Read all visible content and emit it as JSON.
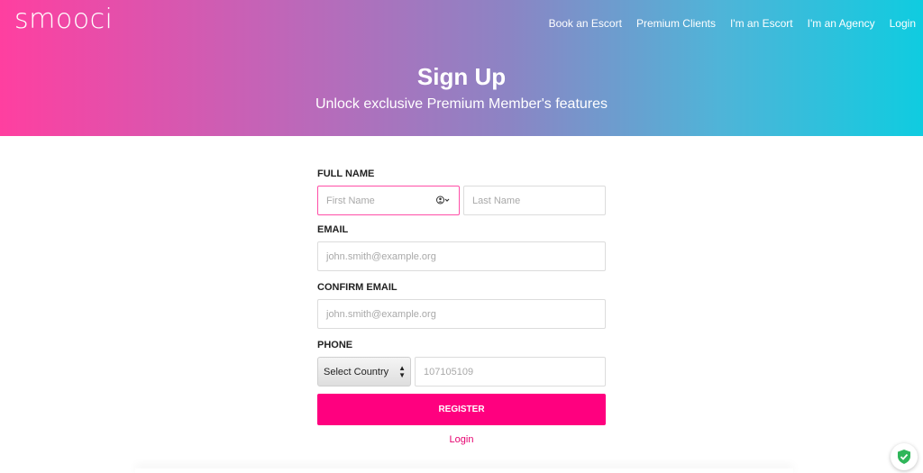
{
  "brand": {
    "logo_text": "smooci"
  },
  "nav": {
    "items": [
      "Book an Escort",
      "Premium Clients",
      "I'm an Escort",
      "I'm an Agency",
      "Login"
    ]
  },
  "hero": {
    "title": "Sign Up",
    "subtitle": "Unlock exclusive Premium Member's features"
  },
  "form": {
    "full_name_label": "FULL NAME",
    "first_name_placeholder": "First Name",
    "last_name_placeholder": "Last Name",
    "email_label": "EMAIL",
    "email_placeholder": "john.smith@example.org",
    "confirm_email_label": "CONFIRM EMAIL",
    "confirm_email_placeholder": "john.smith@example.org",
    "phone_label": "PHONE",
    "country_select_value": "Select Country",
    "phone_placeholder": "107105109",
    "register_label": "REGISTER",
    "login_link": "Login"
  },
  "colors": {
    "accent": "#ff007f",
    "gradient_start": "#ff3fa0",
    "gradient_end": "#0fcce0"
  },
  "icons": [
    "person-contact-icon",
    "chevron-down-icon",
    "select-arrows-icon",
    "shield-check-icon"
  ]
}
